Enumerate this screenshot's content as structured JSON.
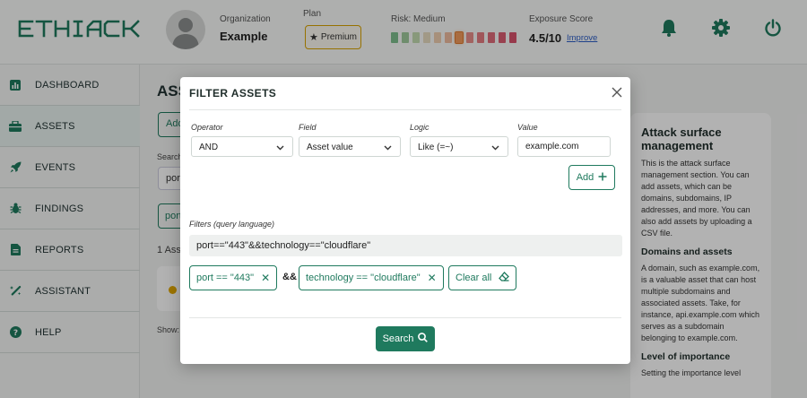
{
  "brand": {
    "logo_text": "ETHIACK",
    "accent": "#1f7a5e"
  },
  "header": {
    "org_label": "Organization",
    "org_name": "Example",
    "plan_label": "Plan",
    "plan_value": "Premium",
    "risk_label": "Risk: Medium",
    "risk_level": 7,
    "risk_scale": 12,
    "exposure_label": "Exposure Score",
    "exposure_value": "4.5/10",
    "improve_link": "Improve",
    "icons": [
      "bell-icon",
      "gear-icon",
      "power-icon"
    ]
  },
  "sidebar": {
    "items": [
      {
        "label": "DASHBOARD",
        "icon": "chart-icon",
        "active": false
      },
      {
        "label": "ASSETS",
        "icon": "assets-icon",
        "active": true
      },
      {
        "label": "EVENTS",
        "icon": "rocket-icon",
        "active": false
      },
      {
        "label": "FINDINGS",
        "icon": "bug-icon",
        "active": false
      },
      {
        "label": "REPORTS",
        "icon": "report-icon",
        "active": false
      },
      {
        "label": "ASSISTANT",
        "icon": "wand-icon",
        "active": false
      },
      {
        "label": "HELP",
        "icon": "help-icon",
        "active": false
      }
    ]
  },
  "background": {
    "page_title": "ASS",
    "add_button": "Add",
    "search_label": "Search",
    "search_value": "port",
    "chip": "port",
    "count_text": "1 Asse",
    "show_text": "Show:"
  },
  "info_panel": {
    "title": "Attack surface management",
    "intro": "This is the attack surface management section. You can add assets, which can be domains, subdomains, IP addresses, and more. You can also add assets by uploading a CSV file.",
    "section1_title": "Domains and assets",
    "section1_text": "A domain, such as example.com, is a valuable asset that can host multiple subdomains and associated assets. Take, for instance, api.example.com which serves as a subdomain belonging to example.com.",
    "section2_title": "Level of importance",
    "section2_text": "Setting the importance level"
  },
  "modal": {
    "title": "FILTER ASSETS",
    "operator_label": "Operator",
    "operator_value": "AND",
    "field_label": "Field",
    "field_value": "Asset value",
    "logic_label": "Logic",
    "logic_value": "Like (=~)",
    "value_label": "Value",
    "value_input": "example.com",
    "add_button": "Add",
    "query_label": "Filters (query language)",
    "query_value": "port==\"443\"&&technology==\"cloudflare\"",
    "chips": [
      {
        "label": "port == \"443\""
      },
      {
        "label": "technology == \"cloudflare\""
      }
    ],
    "joiner": "&&",
    "clear_all": "Clear all",
    "search_button": "Search"
  }
}
